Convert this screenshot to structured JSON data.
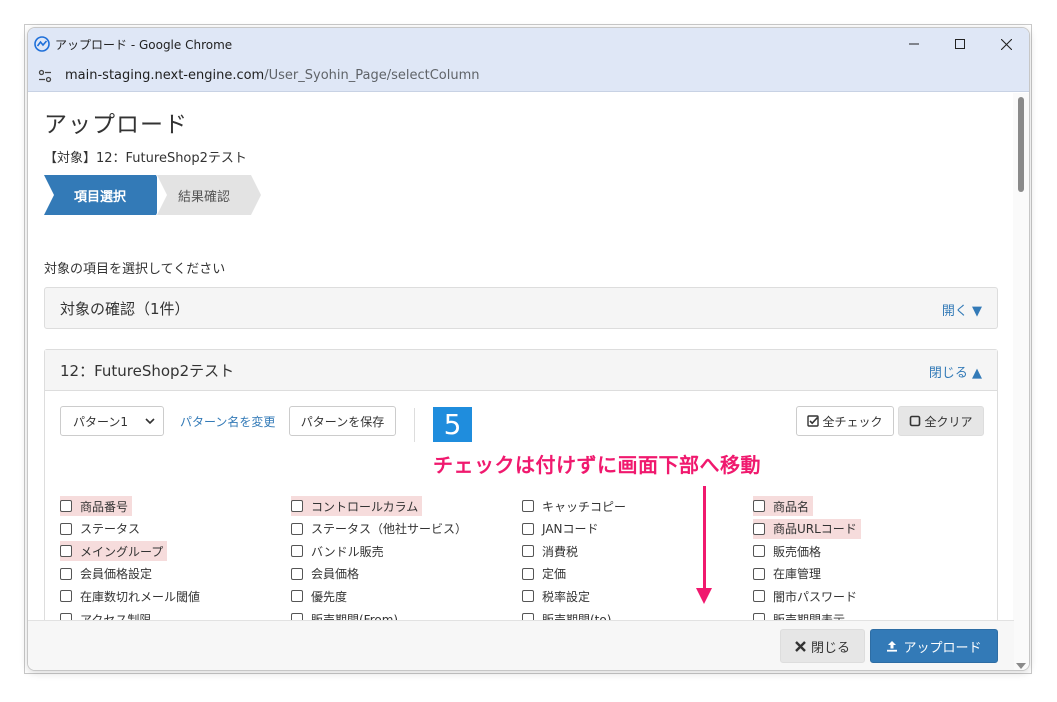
{
  "window": {
    "title": "アップロード - Google Chrome",
    "url_domain": "main-staging.next-engine.com",
    "url_path": "/User_Syohin_Page/selectColumn"
  },
  "page": {
    "title": "アップロード",
    "subject": "【対象】12：FutureShop2テスト",
    "steps": [
      "項目選択",
      "結果確認"
    ],
    "instruction": "対象の項目を選択してください"
  },
  "confirm_panel": {
    "title": "対象の確認（1件）",
    "toggle": "開く ▼"
  },
  "shop_panel": {
    "title": "12：FutureShop2テスト",
    "toggle": "閉じる ▲",
    "pattern_select": "パターン1",
    "rename_link": "パターン名を変更",
    "save_button": "パターンを保存",
    "check_all": "全チェック",
    "clear_all": "全クリア"
  },
  "columns": [
    [
      {
        "label": "商品番号",
        "highlight": true
      },
      {
        "label": "ステータス",
        "highlight": false
      },
      {
        "label": "メイングループ",
        "highlight": true
      },
      {
        "label": "会員価格設定",
        "highlight": false
      },
      {
        "label": "在庫数切れメール閾値",
        "highlight": false
      },
      {
        "label": "アクセス制限",
        "highlight": false
      }
    ],
    [
      {
        "label": "コントロールカラム",
        "highlight": true
      },
      {
        "label": "ステータス（他社サービス）",
        "highlight": false
      },
      {
        "label": "バンドル販売",
        "highlight": false
      },
      {
        "label": "会員価格",
        "highlight": false
      },
      {
        "label": "優先度",
        "highlight": false
      },
      {
        "label": "販売期間(From)",
        "highlight": false
      }
    ],
    [
      {
        "label": "キャッチコピー",
        "highlight": false
      },
      {
        "label": "JANコード",
        "highlight": false
      },
      {
        "label": "消費税",
        "highlight": false
      },
      {
        "label": "定価",
        "highlight": false
      },
      {
        "label": "税率設定",
        "highlight": false
      },
      {
        "label": "販売期間(to)",
        "highlight": false
      }
    ],
    [
      {
        "label": "商品名",
        "highlight": true
      },
      {
        "label": "商品URLコード",
        "highlight": true
      },
      {
        "label": "販売価格",
        "highlight": false
      },
      {
        "label": "在庫管理",
        "highlight": false
      },
      {
        "label": "闇市パスワード",
        "highlight": false
      },
      {
        "label": "販売期間表示",
        "highlight": false
      }
    ]
  ],
  "footer": {
    "close_button": "閉じる",
    "upload_button": "アップロード"
  },
  "annotation": {
    "step_number": "5",
    "text": "チェックは付けずに画面下部へ移動",
    "color": "#f0196e"
  }
}
